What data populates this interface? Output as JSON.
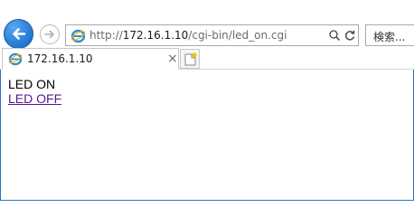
{
  "browser": {
    "address": {
      "url_prefix": "http://",
      "url_host": "172.16.1.10",
      "url_path": "/cgi-bin/led_on.cgi"
    },
    "search_placeholder": "検索...",
    "tabs": [
      {
        "title": "172.16.1.10",
        "close_glyph": "×"
      }
    ]
  },
  "page": {
    "status_text": "LED ON",
    "link_text": "LED OFF"
  },
  "colors": {
    "accent_blue": "#2a7fd6",
    "visited_link": "#551a8b",
    "frame_border": "#2b74c9"
  },
  "icons": {
    "back": "back-arrow-icon",
    "forward": "forward-arrow-icon",
    "site": "ie-logo-icon",
    "address_search": "search-icon",
    "refresh": "refresh-icon",
    "new_tab": "new-tab-icon"
  }
}
